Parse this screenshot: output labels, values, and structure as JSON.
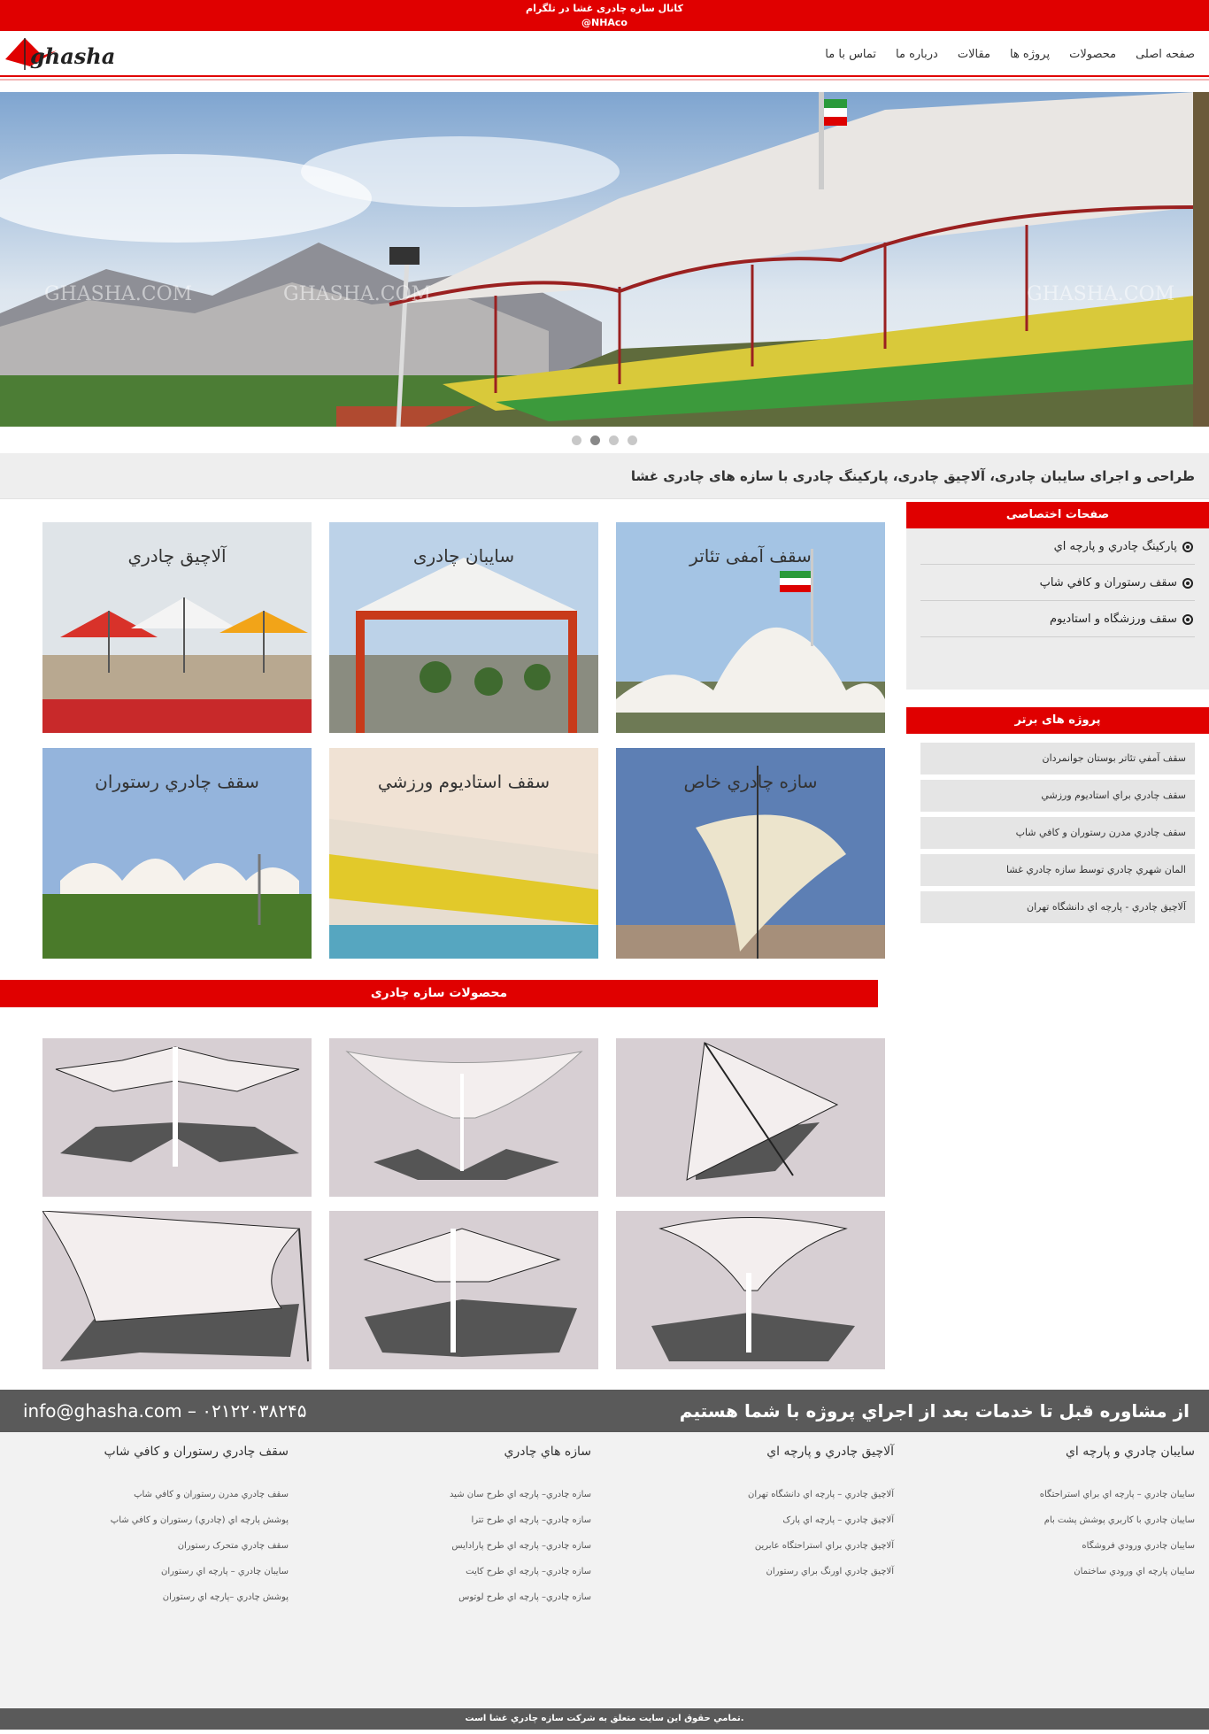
{
  "topbar": {
    "line1": "کانال سازه چادری غشا در تلگرام",
    "line2": "@NHAco"
  },
  "header": {
    "logo_text": "ghasha"
  },
  "nav": [
    "صفحه اصلی",
    "محصولات",
    "پروژه ها",
    "مقالات",
    "درباره ما",
    "تماس با ما"
  ],
  "slider": {
    "watermark": "GHASHA.COM",
    "active_dot": 2,
    "dot_count": 4
  },
  "tagline": "طراحی و اجرای سایبان چادری، آلاچیق چادری، پارکینگ چادری با سازه های چادری غشا",
  "categories": [
    {
      "title": "سقف آمفی تئاتر"
    },
    {
      "title": "سایبان چادری"
    },
    {
      "title": "آلاچيق چادري"
    },
    {
      "title": "سازه چادري خاص"
    },
    {
      "title": "سقف استاديوم ورزشي"
    },
    {
      "title": "سقف چادري رستوران"
    }
  ],
  "sidebar": {
    "special_title": "صفحات اختصاصی",
    "special_links": [
      "پارکینگ چادري و پارچه اي",
      "سقف رستوران و کافي شاپ",
      "سقف ورزشگاه و استاديوم"
    ],
    "projects_title": "پروژه های برتر",
    "projects": [
      "سقف آمفي تئاتر بوستان جوانمردان",
      "سقف چادري براي استاديوم ورزشي",
      "سقف چادري مدرن رستوران و کافي شاپ",
      "المان شهري چادري توسط سازه چادري غشا",
      "آلاچيق چادري - پارچه اي دانشگاه تهران"
    ]
  },
  "products": {
    "title": "محصولات سازه چادری"
  },
  "contact": {
    "left": "info@ghasha.com – ۰۲۱۲۲۰۳۸۲۴۵",
    "right": "از مشاوره قبل تا خدمات بعد از اجراي پروژه با شما هستيم"
  },
  "footer": {
    "columns": [
      {
        "title": "سايبان چادري و پارچه اي",
        "links": [
          "سايبان چادري – پارچه اي براي استراحتگاه",
          "سايبان چادري با کاربري پوشش پشت بام",
          "سايبان چادري ورودي فروشگاه",
          "سايبان پارچه اي ورودي ساختمان"
        ]
      },
      {
        "title": "آلاچيق چادري و پارچه اي",
        "links": [
          "آلاچيق چادري – پارچه اي دانشگاه تهران",
          "آلاچيق چادري – پارچه اي پارک",
          "آلاچيق چادري براي استراحتگاه عابرين",
          "آلاچيق چادري اورنگ براي رستوران"
        ]
      },
      {
        "title": "سازه هاي چادري",
        "links": [
          "سازه چادري– پارچه اي طرح سان شيد",
          "سازه چادري– پارچه اي طرح تترا",
          "سازه چادري– پارچه اي طرح پارادايس",
          "سازه چادري– پارچه اي طرح کايت",
          "سازه چادري– پارچه اي طرح لوتوس"
        ]
      },
      {
        "title": "سقف چادري رستوران و کافي شاپ",
        "links": [
          "سقف چادري مدرن رستوران و کافي شاپ",
          "پوشش پارچه اي (چادري) رستوران و کافي شاپ",
          "سقف چادري متحرک رستوران",
          "سايبان چادري – پارچه اي رستوران",
          "پوشش چادري –پارچه اي رستوران"
        ]
      }
    ]
  },
  "copyright": ".تمامي حقوق اين سايت متعلق به شرکت سازه چادري غشا است"
}
